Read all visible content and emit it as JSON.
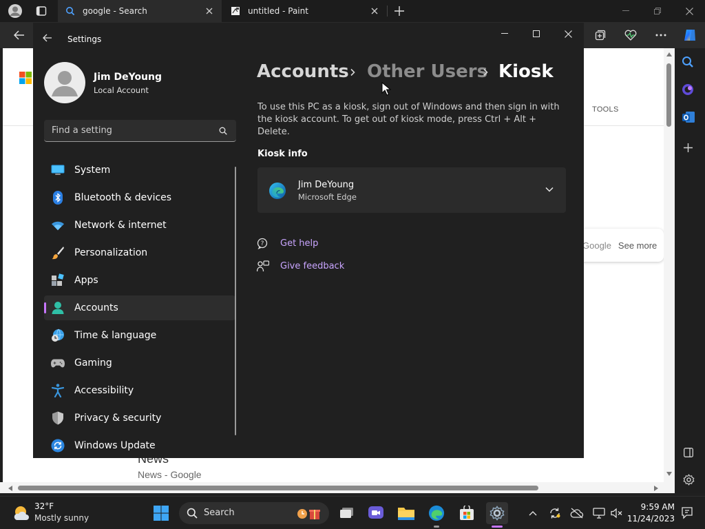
{
  "browser": {
    "tabs": [
      {
        "title": "google - Search",
        "active": true
      },
      {
        "title": "untitled - Paint",
        "active": false
      }
    ],
    "page": {
      "tools_label": "TOOLS",
      "google_brand": "Google",
      "see_more": "See more",
      "news_title": "News",
      "news_source": "News - Google"
    }
  },
  "settings": {
    "title": "Settings",
    "user": {
      "name": "Jim DeYoung",
      "type": "Local Account"
    },
    "search_placeholder": "Find a setting",
    "nav": [
      {
        "label": "System",
        "icon": "system-icon",
        "selected": false
      },
      {
        "label": "Bluetooth & devices",
        "icon": "bluetooth-icon",
        "selected": false
      },
      {
        "label": "Network & internet",
        "icon": "wifi-icon",
        "selected": false
      },
      {
        "label": "Personalization",
        "icon": "brush-icon",
        "selected": false
      },
      {
        "label": "Apps",
        "icon": "apps-icon",
        "selected": false
      },
      {
        "label": "Accounts",
        "icon": "accounts-icon",
        "selected": true
      },
      {
        "label": "Time & language",
        "icon": "globe-clock-icon",
        "selected": false
      },
      {
        "label": "Gaming",
        "icon": "gamepad-icon",
        "selected": false
      },
      {
        "label": "Accessibility",
        "icon": "accessibility-icon",
        "selected": false
      },
      {
        "label": "Privacy & security",
        "icon": "shield-icon",
        "selected": false
      },
      {
        "label": "Windows Update",
        "icon": "update-icon",
        "selected": false
      }
    ],
    "breadcrumb": [
      "Accounts",
      "Other Users",
      "Kiosk"
    ],
    "description": "To use this PC as a kiosk, sign out of Windows and then sign in with the kiosk account. To get out of kiosk mode, press Ctrl + Alt + Delete.",
    "kiosk_info_heading": "Kiosk info",
    "kiosk_card": {
      "name": "Jim DeYoung",
      "app": "Microsoft Edge"
    },
    "links": {
      "help": "Get help",
      "feedback": "Give feedback"
    }
  },
  "taskbar": {
    "weather": {
      "temp": "32°F",
      "condition": "Mostly sunny"
    },
    "search_label": "Search",
    "time": "9:59 AM",
    "date": "11/24/2023"
  },
  "colors": {
    "accent": "#c776ff",
    "link": "#c9a5ff",
    "window_bg": "#202020",
    "card_bg": "#2b2b2b"
  }
}
